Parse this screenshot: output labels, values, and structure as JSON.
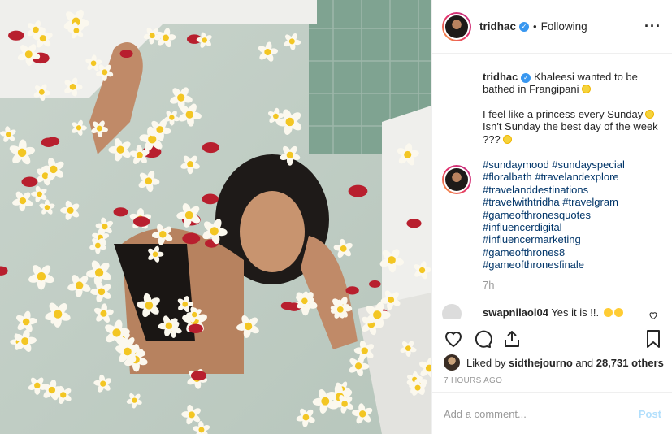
{
  "header": {
    "username": "tridhac",
    "separator": "•",
    "follow_status": "Following"
  },
  "caption": {
    "username": "tridhac",
    "line1": "Khaleesi wanted to be bathed in Frangipani",
    "line2": "I feel like a princess every Sunday",
    "line3": "Isn't Sunday the best day of the week ???"
  },
  "hashtags": [
    "#sundaymood #sundayspecial",
    "#floralbath #travelandexplore",
    "#travelanddestinations",
    "#travelwithtridha #travelgram",
    "#gameofthronesquotes",
    "#influencerdigital",
    "#influencermarketing",
    "#gameofthrones8",
    "#gameofthronesfinale"
  ],
  "time_ago": "7h",
  "reply": {
    "username": "swapnilaol04",
    "text": "Yes it is !!."
  },
  "likes": {
    "prefix": "Liked by",
    "user": "sidthejourno",
    "connector": "and",
    "count": "28,731 others"
  },
  "timestamp": "7 HOURS AGO",
  "comment_box": {
    "placeholder": "Add a comment...",
    "post_label": "Post"
  },
  "icons": {
    "more": "more-options-icon",
    "like": "heart-icon",
    "comment": "comment-bubble-icon",
    "share": "share-icon",
    "save": "bookmark-icon"
  },
  "colors": {
    "link": "#003569",
    "verified": "#3897f0",
    "muted": "#999999",
    "post_button": "#b2dffc"
  }
}
